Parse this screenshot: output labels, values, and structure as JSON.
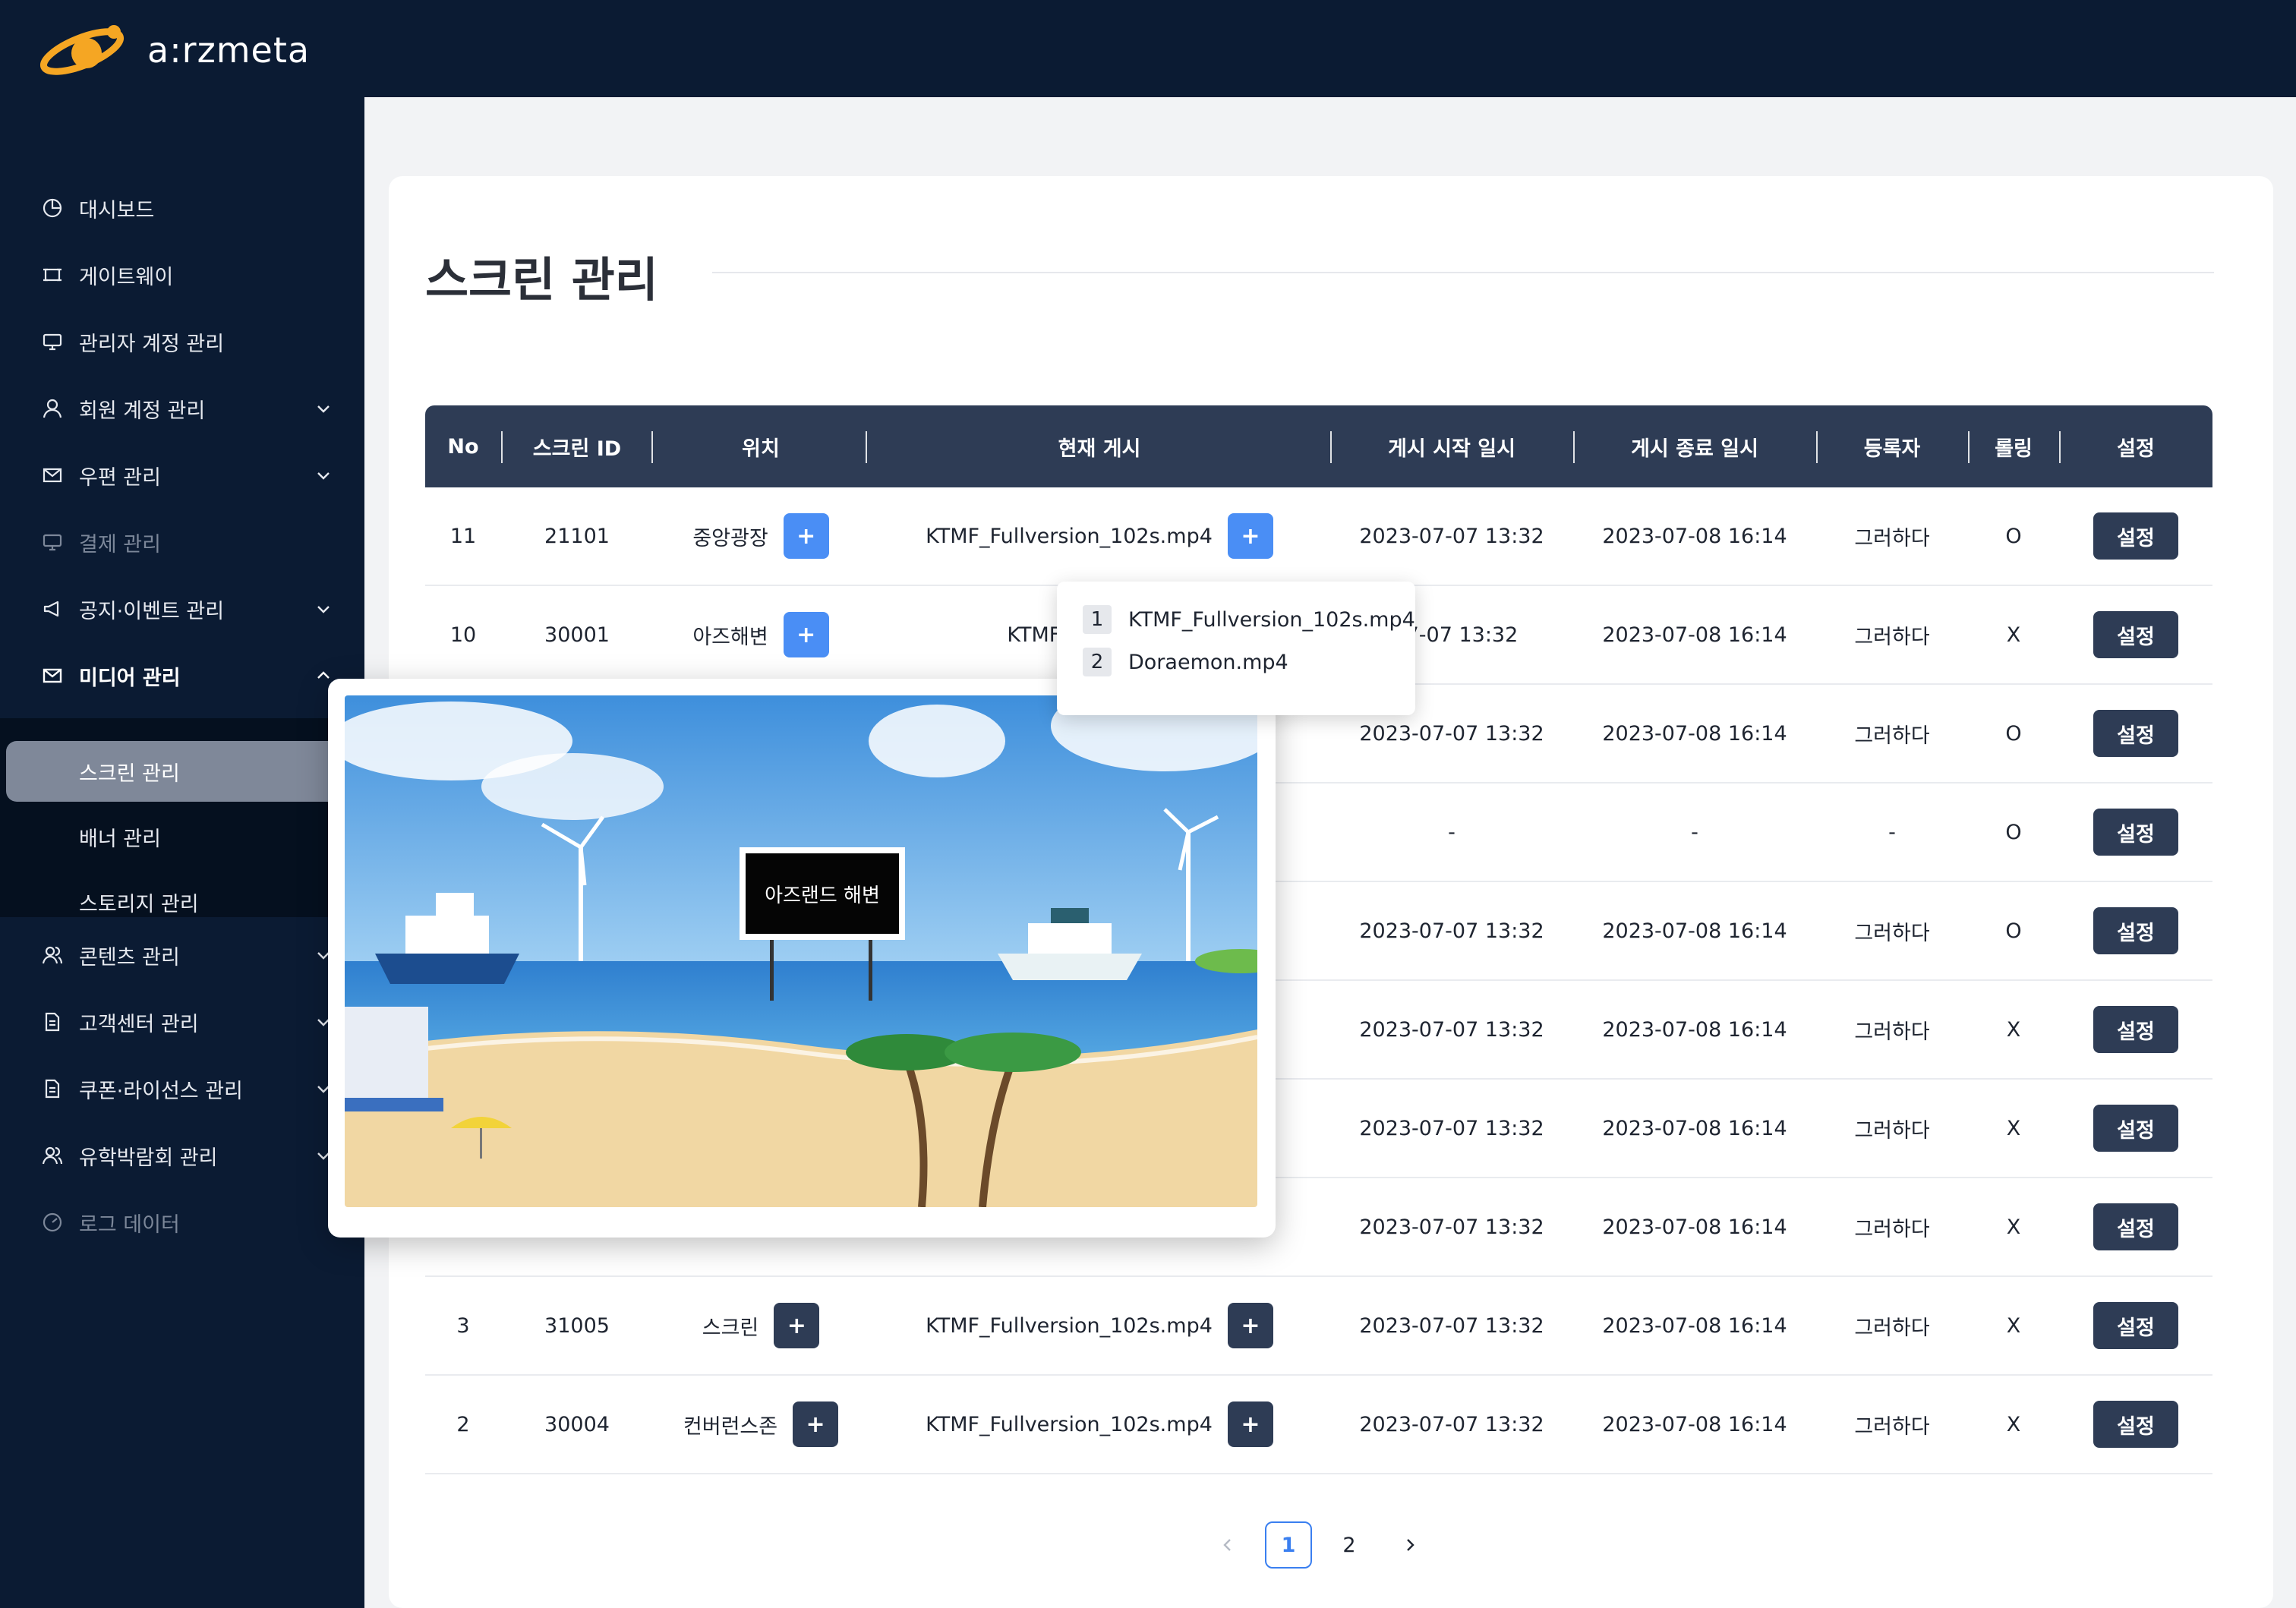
{
  "brand": {
    "name": "a:rzmeta"
  },
  "sidebar": {
    "items": [
      {
        "label": "대시보드",
        "icon": "pie-chart-icon",
        "expandable": false,
        "disabled": false
      },
      {
        "label": "게이트웨이",
        "icon": "gateway-icon",
        "expandable": false,
        "disabled": false
      },
      {
        "label": "관리자 계정 관리",
        "icon": "monitor-icon",
        "expandable": false,
        "disabled": false
      },
      {
        "label": "회원 계정 관리",
        "icon": "user-icon",
        "expandable": true,
        "disabled": false
      },
      {
        "label": "우편 관리",
        "icon": "mail-icon",
        "expandable": true,
        "disabled": false
      },
      {
        "label": "결제 관리",
        "icon": "monitor-icon",
        "expandable": false,
        "disabled": true
      },
      {
        "label": "공지·이벤트 관리",
        "icon": "megaphone-icon",
        "expandable": true,
        "disabled": false
      },
      {
        "label": "미디어 관리",
        "icon": "mail-icon",
        "expandable": true,
        "expanded": true,
        "disabled": false
      },
      {
        "label": "콘텐츠 관리",
        "icon": "users-icon",
        "expandable": true,
        "disabled": false
      },
      {
        "label": "고객센터 관리",
        "icon": "document-icon",
        "expandable": true,
        "disabled": false
      },
      {
        "label": "쿠폰·라이선스 관리",
        "icon": "document-icon",
        "expandable": true,
        "disabled": false
      },
      {
        "label": "유학박람회 관리",
        "icon": "users-icon",
        "expandable": true,
        "disabled": false
      },
      {
        "label": "로그 데이터",
        "icon": "gauge-icon",
        "expandable": false,
        "disabled": true
      }
    ],
    "media_submenu": [
      {
        "label": "스크린 관리",
        "selected": true
      },
      {
        "label": "배너 관리",
        "selected": false
      },
      {
        "label": "스토리지 관리",
        "selected": false
      }
    ]
  },
  "page": {
    "title": "스크린 관리"
  },
  "table": {
    "columns": [
      "No",
      "스크린 ID",
      "위치",
      "현재 게시",
      "게시 시작 일시",
      "게시 종료 일시",
      "등록자",
      "롤링",
      "설정"
    ],
    "settings_label": "설정",
    "plus_label": "+",
    "rows": [
      {
        "no": "11",
        "screen_id": "21101",
        "location": "중앙광장",
        "current": "KTMF_Fullversion_102s.mp4",
        "start": "2023-07-07 13:32",
        "end": "2023-07-08 16:14",
        "registrant": "그러하다",
        "rolling": "O"
      },
      {
        "no": "10",
        "screen_id": "30001",
        "location": "아즈해변",
        "current": "KTMF_Fullve",
        "start": "-07-07 13:32",
        "end": "2023-07-08 16:14",
        "registrant": "그러하다",
        "rolling": "X"
      },
      {
        "no": "",
        "screen_id": "",
        "location": "",
        "current": "",
        "start": "2023-07-07 13:32",
        "end": "2023-07-08 16:14",
        "registrant": "그러하다",
        "rolling": "O"
      },
      {
        "no": "",
        "screen_id": "",
        "location": "",
        "current": "",
        "start": "-",
        "end": "-",
        "registrant": "-",
        "rolling": "O"
      },
      {
        "no": "",
        "screen_id": "",
        "location": "",
        "current": "",
        "start": "2023-07-07 13:32",
        "end": "2023-07-08 16:14",
        "registrant": "그러하다",
        "rolling": "O"
      },
      {
        "no": "",
        "screen_id": "",
        "location": "",
        "current": "",
        "start": "2023-07-07 13:32",
        "end": "2023-07-08 16:14",
        "registrant": "그러하다",
        "rolling": "X"
      },
      {
        "no": "",
        "screen_id": "",
        "location": "",
        "current": "",
        "start": "2023-07-07 13:32",
        "end": "2023-07-08 16:14",
        "registrant": "그러하다",
        "rolling": "X"
      },
      {
        "no": "",
        "screen_id": "",
        "location": "",
        "current": "",
        "start": "2023-07-07 13:32",
        "end": "2023-07-08 16:14",
        "registrant": "그러하다",
        "rolling": "X"
      },
      {
        "no": "3",
        "screen_id": "31005",
        "location": "스크린",
        "current": "KTMF_Fullversion_102s.mp4",
        "start": "2023-07-07 13:32",
        "end": "2023-07-08 16:14",
        "registrant": "그러하다",
        "rolling": "X"
      },
      {
        "no": "2",
        "screen_id": "30004",
        "location": "컨버런스존",
        "current": "KTMF_Fullversion_102s.mp4",
        "start": "2023-07-07 13:32",
        "end": "2023-07-08 16:14",
        "registrant": "그러하다",
        "rolling": "X"
      }
    ]
  },
  "popover": {
    "items": [
      {
        "index": "1",
        "file": "KTMF_Fullversion_102s.mp4"
      },
      {
        "index": "2",
        "file": "Doraemon.mp4"
      }
    ]
  },
  "preview": {
    "sign_text": "아즈랜드 해변"
  },
  "pagination": {
    "pages": [
      "1",
      "2"
    ],
    "current": "1"
  },
  "colors": {
    "navy": "#0b1b33",
    "header": "#2e3c55",
    "accent": "#4a8ef5"
  }
}
